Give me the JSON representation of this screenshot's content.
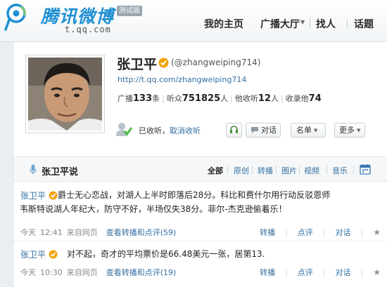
{
  "header": {
    "logo_name": "腾讯微博",
    "logo_badge": "测试版",
    "logo_domain": "t.qq.com",
    "nav": [
      "我的主页",
      "广播大厅",
      "找人",
      "话题"
    ]
  },
  "profile": {
    "name": "张卫平",
    "handle": "(@zhangweiping714)",
    "url": "http://t.qq.com/zhangweiping714",
    "stats": [
      {
        "label": "广播",
        "value": "133",
        "unit": "条"
      },
      {
        "label": "听众",
        "value": "751825",
        "unit": "人"
      },
      {
        "label": "他收听",
        "value": "12",
        "unit": "人"
      },
      {
        "label": "收录他",
        "value": "74",
        "unit": ""
      }
    ],
    "follow_status": "已收听，",
    "unfollow_label": "取消收听",
    "buttons": {
      "chat": "对话",
      "list": "名单",
      "more": "更多"
    }
  },
  "tabs": {
    "title": "张卫平说",
    "items": [
      "全部",
      "原创",
      "转播",
      "图片",
      "视频",
      "音乐"
    ]
  },
  "posts": [
    {
      "author": "张卫平",
      "text_line1": "爵士无心恋战，对湖人上半时即落后28分。科比和费什尔用行动反驳恩师",
      "text_line2": "韦斯特说湖人年纪大，防守不好，半场仅失38分。菲尔-杰克逊偷着乐！",
      "date": "今天",
      "time": "12:41",
      "source": "来自网页",
      "view_label": "查看转播和点评",
      "count": "(59)",
      "actions": {
        "repost": "转播",
        "comment": "点评",
        "chat": "对话"
      }
    },
    {
      "author": "张卫平",
      "text": "对不起，奇才的平均票价是66.48美元一张，居第13.",
      "date": "今天",
      "time": "10:30",
      "source": "来自网页",
      "view_label": "查看转播和点评",
      "count": "(19)",
      "actions": {
        "repost": "转播",
        "comment": "点评",
        "chat": "对话"
      }
    }
  ],
  "colors": {
    "link": "#346fa0",
    "brand": "#1f8fd3",
    "vip": "#f2a40c"
  }
}
